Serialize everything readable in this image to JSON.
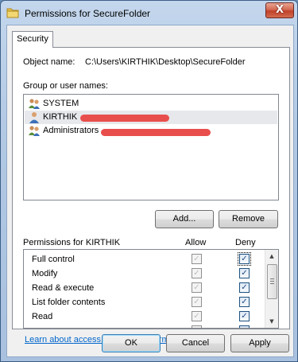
{
  "window": {
    "title": "Permissions for SecureFolder",
    "close_glyph": "X",
    "icon": "folder-icon"
  },
  "tabs": [
    {
      "label": "Security",
      "selected": true
    }
  ],
  "object": {
    "label": "Object name:",
    "value": "C:\\Users\\KIRTHIK\\Desktop\\SecureFolder"
  },
  "groups": {
    "label": "Group or user names:",
    "items": [
      {
        "name": "SYSTEM",
        "icon": "user-group-icon",
        "selected": false
      },
      {
        "name": "KIRTHIK",
        "icon": "user-icon",
        "selected": true
      },
      {
        "name": "Administrators",
        "icon": "user-group-icon",
        "selected": false
      }
    ],
    "add_label": "Add...",
    "remove_label": "Remove"
  },
  "permissions": {
    "header": "Permissions for KIRTHIK",
    "allow_label": "Allow",
    "deny_label": "Deny",
    "rows": [
      {
        "name": "Full control",
        "allow": true,
        "deny": true
      },
      {
        "name": "Modify",
        "allow": true,
        "deny": true
      },
      {
        "name": "Read & execute",
        "allow": true,
        "deny": true
      },
      {
        "name": "List folder contents",
        "allow": true,
        "deny": true
      },
      {
        "name": "Read",
        "allow": true,
        "deny": true
      }
    ],
    "check_glyph": "✓",
    "scroll_up": "▲",
    "scroll_down": "▼"
  },
  "link_text": "Learn about access control and permissions",
  "buttons": {
    "ok": "OK",
    "cancel": "Cancel",
    "apply": "Apply"
  },
  "colors": {
    "redaction": "#e84f4c",
    "link": "#0066cc"
  }
}
